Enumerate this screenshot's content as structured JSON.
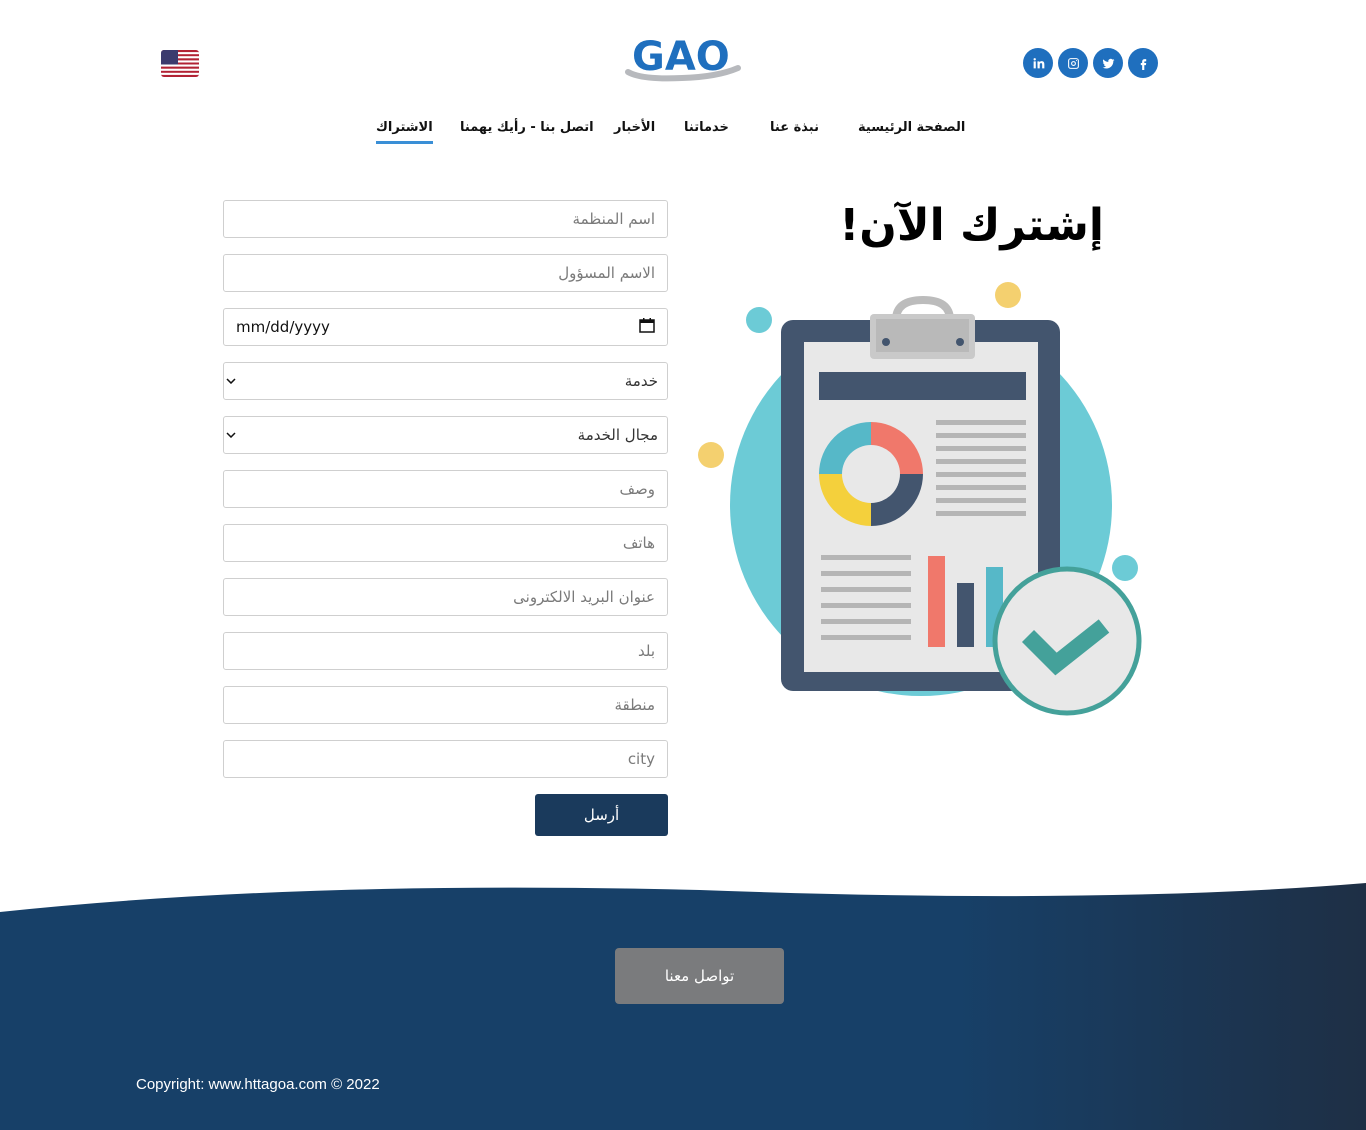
{
  "header": {
    "language_flag": "us-flag-icon",
    "logo_text": "GAO",
    "social": [
      {
        "name": "facebook-icon",
        "glyph": "f"
      },
      {
        "name": "twitter-icon",
        "glyph": ""
      },
      {
        "name": "instagram-icon",
        "glyph": ""
      },
      {
        "name": "linkedin-icon",
        "glyph": "in"
      }
    ]
  },
  "nav": {
    "items": [
      {
        "label": "الصفحة الرئيسية"
      },
      {
        "label": "نبذة عنا"
      },
      {
        "label": "خدماتنا"
      },
      {
        "label": "الأخبار"
      },
      {
        "label": "اتصل بنا - رأيك يهمنا"
      },
      {
        "label": "الاشتراك"
      }
    ]
  },
  "hero": {
    "title": "إشترك الآن!"
  },
  "form": {
    "org_name_placeholder": "اسم المنظمة",
    "responsible_name_placeholder": "الاسم المسؤول",
    "date_placeholder": "mm/dd/yyyy",
    "service_selected": "خدمة",
    "service_field_selected": "مجال الخدمة",
    "description_placeholder": "وصف",
    "phone_placeholder": "هاتف",
    "email_placeholder": "عنوان البريد الالكترونى",
    "country_placeholder": "بلد",
    "region_placeholder": "منطقة",
    "city_placeholder": "city",
    "submit_label": "أرسل"
  },
  "footer": {
    "contact_label": "تواصل معنا",
    "copyright": "Copyright: www.httagoa.com © 2022"
  },
  "colors": {
    "primary": "#1a3a5c",
    "accent": "#3a8fd6",
    "social": "#1f6fbe",
    "footer": "#174068",
    "contact_button": "#7a7b7d"
  }
}
